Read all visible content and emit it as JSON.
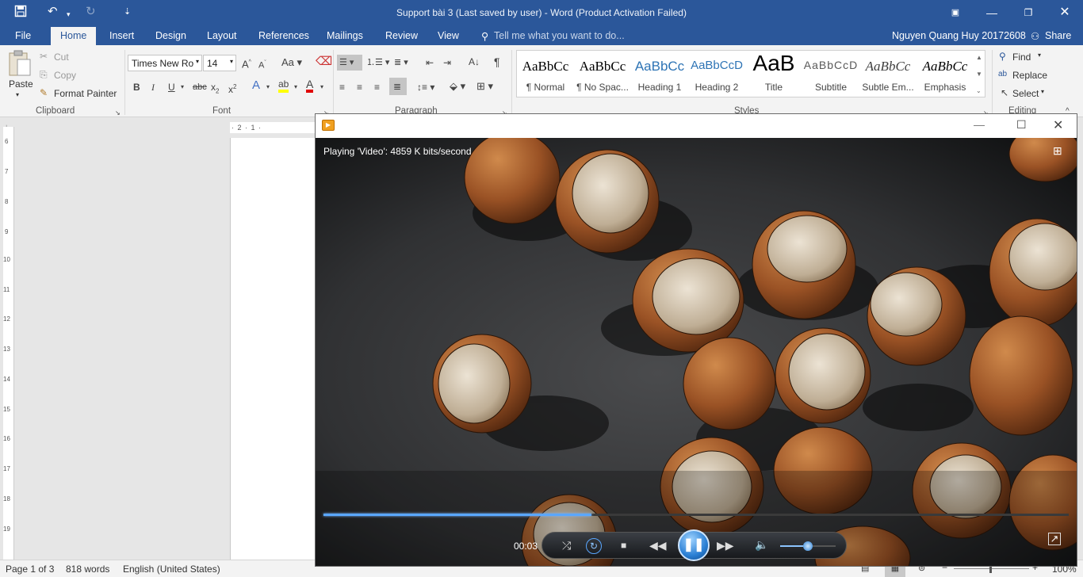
{
  "titlebar": {
    "title": "Support bài 3 (Last saved by user) - Word (Product Activation Failed)",
    "qat_more": "⇣"
  },
  "tabs": [
    "File",
    "Home",
    "Insert",
    "Design",
    "Layout",
    "References",
    "Mailings",
    "Review",
    "View"
  ],
  "tell_me": "Tell me what you want to do...",
  "user": "Nguyen Quang Huy 20172608",
  "share": "Share",
  "clipboard": {
    "paste": "Paste",
    "cut": "Cut",
    "copy": "Copy",
    "format_painter": "Format Painter",
    "label": "Clipboard"
  },
  "font": {
    "name": "Times New Ro",
    "size": "14",
    "label": "Font"
  },
  "paragraph": {
    "label": "Paragraph"
  },
  "styles": {
    "label": "Styles",
    "items": [
      {
        "preview": "AaBbCc",
        "name": "¶ Normal"
      },
      {
        "preview": "AaBbCc",
        "name": "¶ No Spac..."
      },
      {
        "preview": "AaBbCc",
        "name": "Heading 1"
      },
      {
        "preview": "AaBbCcD",
        "name": "Heading 2"
      },
      {
        "preview": "AaB",
        "name": "Title"
      },
      {
        "preview": "AaBbCcD",
        "name": "Subtitle"
      },
      {
        "preview": "AaBbCc",
        "name": "Subtle Em..."
      },
      {
        "preview": "AaBbCc",
        "name": "Emphasis"
      }
    ]
  },
  "editing": {
    "find": "Find",
    "replace": "Replace",
    "select": "Select",
    "label": "Editing"
  },
  "ruler": {
    "horizontal": "· 2 · 1 ·"
  },
  "vruler_numbers": [
    "6",
    "7",
    "8",
    "9",
    "10",
    "11",
    "12",
    "13",
    "14",
    "15",
    "16",
    "17",
    "18",
    "19"
  ],
  "status": {
    "page": "Page 1 of 3",
    "words": "818 words",
    "language": "English (United States)",
    "zoom": "100%"
  },
  "player": {
    "status_text": "Playing 'Video': 4859 K bits/second",
    "time": "00:03",
    "progress": 0.36,
    "volume": 0.5
  },
  "colors": {
    "word_blue": "#2b579a",
    "seek_blue": "#5aa7ff",
    "highlight": "#ffff00",
    "font_color": "#e00000"
  }
}
